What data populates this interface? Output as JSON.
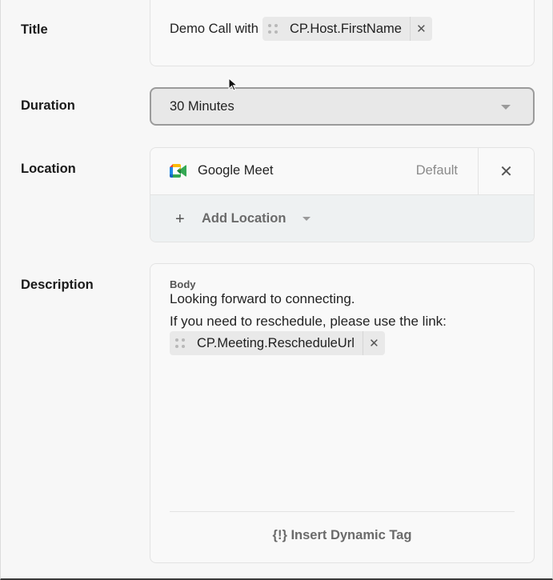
{
  "fields": {
    "title": {
      "label": "Title",
      "prefix": "Demo Call with",
      "tag": "CP.Host.FirstName"
    },
    "duration": {
      "label": "Duration",
      "value": "30 Minutes"
    },
    "location": {
      "label": "Location",
      "item": {
        "name": "Google Meet",
        "badge": "Default",
        "icon": "google-meet-icon"
      },
      "add_label": "Add Location"
    },
    "description": {
      "label": "Description",
      "body_label": "Body",
      "line1": "Looking forward to connecting.",
      "line2": "If you need to reschedule, please use the link:",
      "tag": "CP.Meeting.RescheduleUrl",
      "insert_label": "{!} Insert Dynamic Tag"
    }
  },
  "icons": {
    "remove": "close-icon",
    "drag": "drag-handle-icon",
    "dropdown": "caret-down-icon",
    "add": "plus-icon"
  },
  "colors": {
    "page_bg": "#f7f7f7",
    "card_bg": "#f9f9f9",
    "chip_bg": "#e9e9e9",
    "select_bg": "#e8e8e8",
    "add_row_bg": "#eef1f2"
  }
}
